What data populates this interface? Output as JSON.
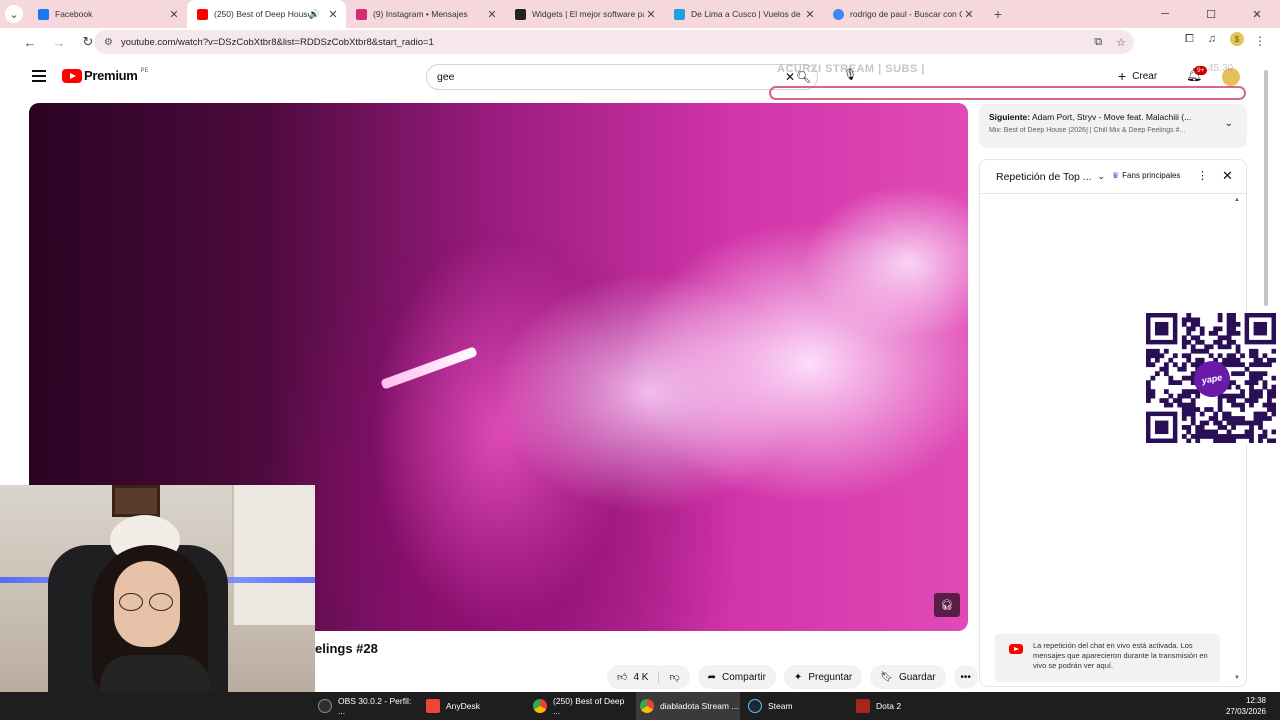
{
  "browser": {
    "tabs": [
      {
        "title": "Facebook",
        "color": "#1877f2",
        "active": false,
        "audio": false
      },
      {
        "title": "(250) Best of Deep House [",
        "color": "#ff0000",
        "active": true,
        "audio": true
      },
      {
        "title": "(9) Instagram • Mensajes",
        "color": "#d62976",
        "active": false,
        "audio": false
      },
      {
        "title": "Widgets | El mejor software pa",
        "color": "#222222",
        "active": false,
        "audio": false
      },
      {
        "title": "De Lima a Cusco | Vuelos de Gi",
        "color": "#1ba0e2",
        "active": false,
        "audio": false
      },
      {
        "title": "rodrigo de paul - Buscar con G",
        "color": "#4285f4",
        "active": false,
        "audio": false
      }
    ],
    "url": "youtube.com/watch?v=DSzCobXtbr8&list=RDDSzCobXtbr8&start_radio=1"
  },
  "youtube": {
    "logo_word": "Premium",
    "logo_country": "PE",
    "search_value": "gee",
    "overlay_text": "ACURZI STREAM | SUBS |",
    "create_label": "Crear",
    "notif_badge": "9+",
    "time_overlay": "45:30"
  },
  "video": {
    "title_fragment": "elings #28",
    "like_count": "4 K",
    "share_label": "Compartir",
    "ask_label": "Preguntar",
    "save_label": "Guardar"
  },
  "up_next": {
    "prefix": "Siguiente:",
    "title": "Adam Port, Stryv - Move feat. Malachiii (...",
    "mix": "Mix: Best of Deep House [2026] | Chill Mix & Deep Feelings #..."
  },
  "chat": {
    "header_title": "Repetición de Top ...",
    "fans_label": "Fans principales",
    "notice": "La repetición del chat en vivo está activada. Los mensajes que aparecieron durante la transmisión en vivo se podrán ver aquí."
  },
  "qr": {
    "brand": "yape"
  },
  "taskbar": {
    "items": [
      {
        "label": "OBS 30.0.2 - Perfil: ...",
        "color": "#302e31",
        "active": false
      },
      {
        "label": "AnyDesk",
        "color": "#ef443b",
        "active": false
      },
      {
        "label": "(250) Best of Deep ...",
        "color": "#4285f4",
        "active": false
      },
      {
        "label": "diabladota Stream ...",
        "color": "#4285f4",
        "active": true
      },
      {
        "label": "Steam",
        "color": "#1b2838",
        "active": false
      },
      {
        "label": "Dota 2",
        "color": "#a8251e",
        "active": false
      }
    ],
    "time": "12:38",
    "date": "27/03/2026"
  }
}
